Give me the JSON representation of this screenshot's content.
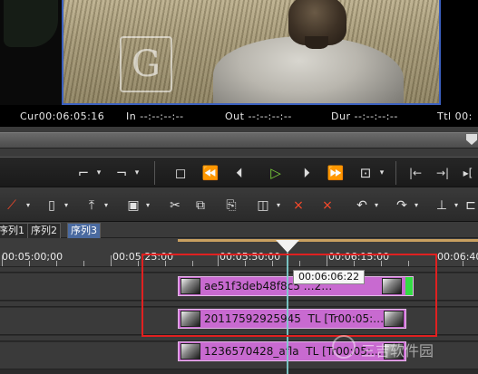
{
  "timecodes": {
    "cur_label": "Cur",
    "cur_value": "00:06:05:16",
    "in_label": "In",
    "in_value": "--:--:--:--",
    "out_label": "Out",
    "out_value": "--:--:--:--",
    "dur_label": "Dur",
    "dur_value": "--:--:--:--",
    "ttl_label": "Ttl",
    "ttl_value": "00:"
  },
  "video": {
    "watermark_letters": "G"
  },
  "transport": {
    "buttons": [
      "mark-in",
      "mark-out",
      "stop",
      "rewind",
      "step-back",
      "play",
      "step-forward",
      "fast-forward",
      "loop",
      "match-frame-in",
      "match-frame-out",
      "split"
    ]
  },
  "edit_toolbar": {
    "buttons": [
      "razor",
      "new",
      "export",
      "save",
      "cut",
      "copy",
      "paste",
      "insert",
      "delete",
      "ripple-delete",
      "undo",
      "redo",
      "audio"
    ]
  },
  "sequence_tabs": [
    {
      "label": "序列1",
      "active": false
    },
    {
      "label": "序列2",
      "active": false
    },
    {
      "label": "序列3",
      "active": true
    }
  ],
  "ruler": {
    "labels": [
      "00:05:00;00",
      "00:05:25:00",
      "00:05:50:00",
      "00:06:15:00",
      "00:06:40"
    ]
  },
  "tooltip": "00:06:06:22",
  "clips": [
    {
      "name": "ae51f3deb48f8c5",
      "trailing": "…2…"
    },
    {
      "name": "20117592925945",
      "trailing": "TL [Tr00:05:…"
    },
    {
      "name": "1236570428_afla",
      "trailing": "TL [Tr00:05:…"
    }
  ],
  "watermark": "三吉软件园",
  "colors": {
    "accent": "#7ad13a",
    "clip": "#c86ad0",
    "highlight_box": "#e02020",
    "tab_active": "#4a6aa0"
  }
}
